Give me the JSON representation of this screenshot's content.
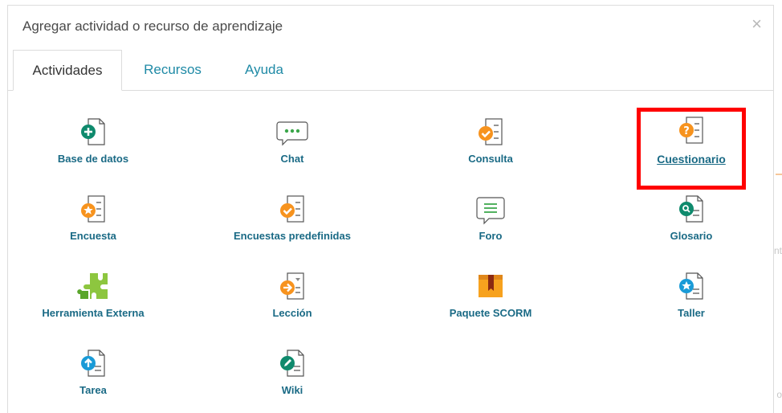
{
  "dialog": {
    "title": "Agregar actividad o recurso de aprendizaje",
    "close_label": "×"
  },
  "tabs": [
    {
      "label": "Actividades",
      "active": true
    },
    {
      "label": "Recursos",
      "active": false
    },
    {
      "label": "Ayuda",
      "active": false
    }
  ],
  "items": [
    {
      "label": "Base de datos",
      "icon": "database-icon"
    },
    {
      "label": "Chat",
      "icon": "chat-icon"
    },
    {
      "label": "Consulta",
      "icon": "choice-icon"
    },
    {
      "label": "Cuestionario",
      "icon": "quiz-icon"
    },
    {
      "label": "Encuesta",
      "icon": "feedback-icon"
    },
    {
      "label": "Encuestas predefinidas",
      "icon": "survey-icon"
    },
    {
      "label": "Foro",
      "icon": "forum-icon"
    },
    {
      "label": "Glosario",
      "icon": "glossary-icon"
    },
    {
      "label": "Herramienta Externa",
      "icon": "lti-puzzle-icon"
    },
    {
      "label": "Lección",
      "icon": "lesson-icon"
    },
    {
      "label": "Paquete SCORM",
      "icon": "scorm-package-icon"
    },
    {
      "label": "Taller",
      "icon": "workshop-icon"
    },
    {
      "label": "Tarea",
      "icon": "assignment-icon"
    },
    {
      "label": "Wiki",
      "icon": "wiki-icon"
    }
  ],
  "colors": {
    "link": "#1a6a85",
    "tab_link": "#1f8aa6",
    "highlight_border": "#ff0000",
    "teal": "#0f8a6d",
    "orange": "#f7931e",
    "blue": "#1a9bd7"
  },
  "background_fragments": {
    "right_edge_top": "nt",
    "right_edge_bottom": "o"
  }
}
